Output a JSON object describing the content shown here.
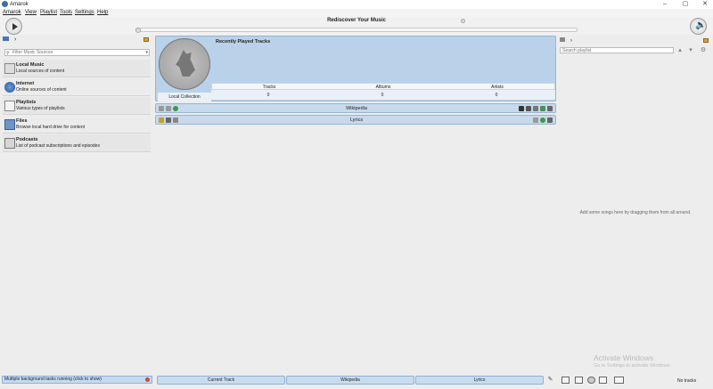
{
  "window": {
    "title": "Amarok",
    "minimize": "–",
    "maximize": "▢",
    "close": "✕"
  },
  "menu": [
    "Amarok",
    "View",
    "Playlist",
    "Tools",
    "Settings",
    "Help"
  ],
  "toolbar": {
    "banner": "Rediscover Your Music",
    "progress": 0.0
  },
  "sources": {
    "filter_placeholder": "Filter Music Sources",
    "items": [
      {
        "name": "Local Music",
        "desc": "Local sources of content",
        "icon": "local-music-icon"
      },
      {
        "name": "Internet",
        "desc": "Online sources of content",
        "icon": "internet-globe-icon"
      },
      {
        "name": "Playlists",
        "desc": "Various types of playlists",
        "icon": "playlist-icon"
      },
      {
        "name": "Files",
        "desc": "Browse local hard drive for content",
        "icon": "folder-icon"
      },
      {
        "name": "Podcasts",
        "desc": "List of podcast subscriptions and episodes",
        "icon": "podcast-icon"
      }
    ]
  },
  "context": {
    "recent_title": "Recently Played Tracks",
    "stats": {
      "headers": [
        "Tracks",
        "Albums",
        "Artists"
      ],
      "values": [
        "0",
        "0",
        "0"
      ],
      "collection_label": "Local Collection"
    },
    "applets": [
      "Wikipedia",
      "Lyrics"
    ]
  },
  "playlist": {
    "search_placeholder": "Search playlist",
    "empty_hint": "Add some songs here by dragging them from all around."
  },
  "watermark": {
    "line1": "Activate Windows",
    "line2": "Go to Settings to activate Windows."
  },
  "status": {
    "tasks": "Multiple background tasks running (click to show)",
    "tabs": [
      "Current Track",
      "Wikipedia",
      "Lyrics"
    ],
    "track_count": "No tracks"
  }
}
